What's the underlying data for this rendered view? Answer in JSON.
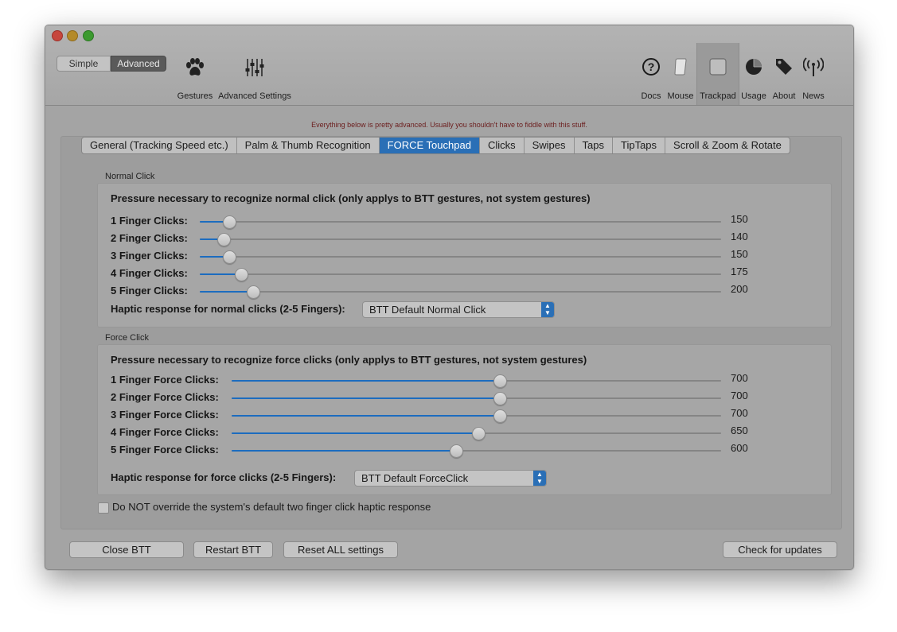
{
  "toolbar": {
    "mode_simple": "Simple",
    "mode_advanced": "Advanced",
    "left_items": [
      {
        "label": "Gestures",
        "icon": "paw-icon"
      },
      {
        "label": "Advanced Settings",
        "icon": "sliders-icon"
      }
    ],
    "right_items": [
      {
        "label": "Docs",
        "icon": "question-icon"
      },
      {
        "label": "Mouse",
        "icon": "mouse-icon"
      },
      {
        "label": "Trackpad",
        "icon": "trackpad-icon",
        "selected": true
      },
      {
        "label": "Usage",
        "icon": "pie-chart-icon"
      },
      {
        "label": "About",
        "icon": "tag-icon"
      },
      {
        "label": "News",
        "icon": "antenna-icon"
      }
    ]
  },
  "notice": "Everything below is pretty advanced. Usually you shouldn't have to fiddle with this stuff.",
  "tabs": [
    {
      "label": "General (Tracking Speed etc.)"
    },
    {
      "label": "Palm & Thumb Recognition"
    },
    {
      "label": "FORCE Touchpad",
      "active": true
    },
    {
      "label": "Clicks"
    },
    {
      "label": "Swipes"
    },
    {
      "label": "Taps"
    },
    {
      "label": "TipTaps"
    },
    {
      "label": "Scroll & Zoom & Rotate"
    }
  ],
  "normal": {
    "title": "Normal Click",
    "heading": "Pressure necessary to recognize normal click (only applys to BTT gestures, not system gestures)",
    "sliders": [
      {
        "label": "1 Finger Clicks:",
        "value": "150",
        "level": 0.055
      },
      {
        "label": "2 Finger Clicks:",
        "value": "140",
        "level": 0.045
      },
      {
        "label": "3 Finger Clicks:",
        "value": "150",
        "level": 0.055
      },
      {
        "label": "4 Finger Clicks:",
        "value": "175",
        "level": 0.078
      },
      {
        "label": "5 Finger Clicks:",
        "value": "200",
        "level": 0.1
      }
    ],
    "haptic_label": "Haptic response for normal clicks (2-5 Fingers):",
    "haptic_value": "BTT Default Normal Click"
  },
  "force": {
    "title": "Force Click",
    "heading": "Pressure necessary to recognize force clicks  (only applys to BTT gestures, not system gestures)",
    "sliders": [
      {
        "label": "1 Finger Force Clicks:",
        "value": "700",
        "level": 0.546
      },
      {
        "label": "2 Finger Force Clicks:",
        "value": "700",
        "level": 0.546
      },
      {
        "label": "3 Finger Force Clicks:",
        "value": "700",
        "level": 0.546
      },
      {
        "label": "4 Finger Force Clicks:",
        "value": "650",
        "level": 0.502
      },
      {
        "label": "5 Finger Force Clicks:",
        "value": "600",
        "level": 0.457
      }
    ],
    "haptic_label": "Haptic response for force clicks (2-5 Fingers):",
    "haptic_value": "BTT Default ForceClick"
  },
  "checkbox_label": "Do NOT override the system's default two finger click haptic response",
  "checkbox_checked": false,
  "buttons": {
    "close": "Close BTT",
    "restart": "Restart BTT",
    "reset": "Reset ALL settings",
    "updates": "Check for updates"
  },
  "colors": {
    "accent": "#2a6fb6",
    "slider_fill": "#1c6cbf",
    "notice_text": "#6b1d1d"
  }
}
